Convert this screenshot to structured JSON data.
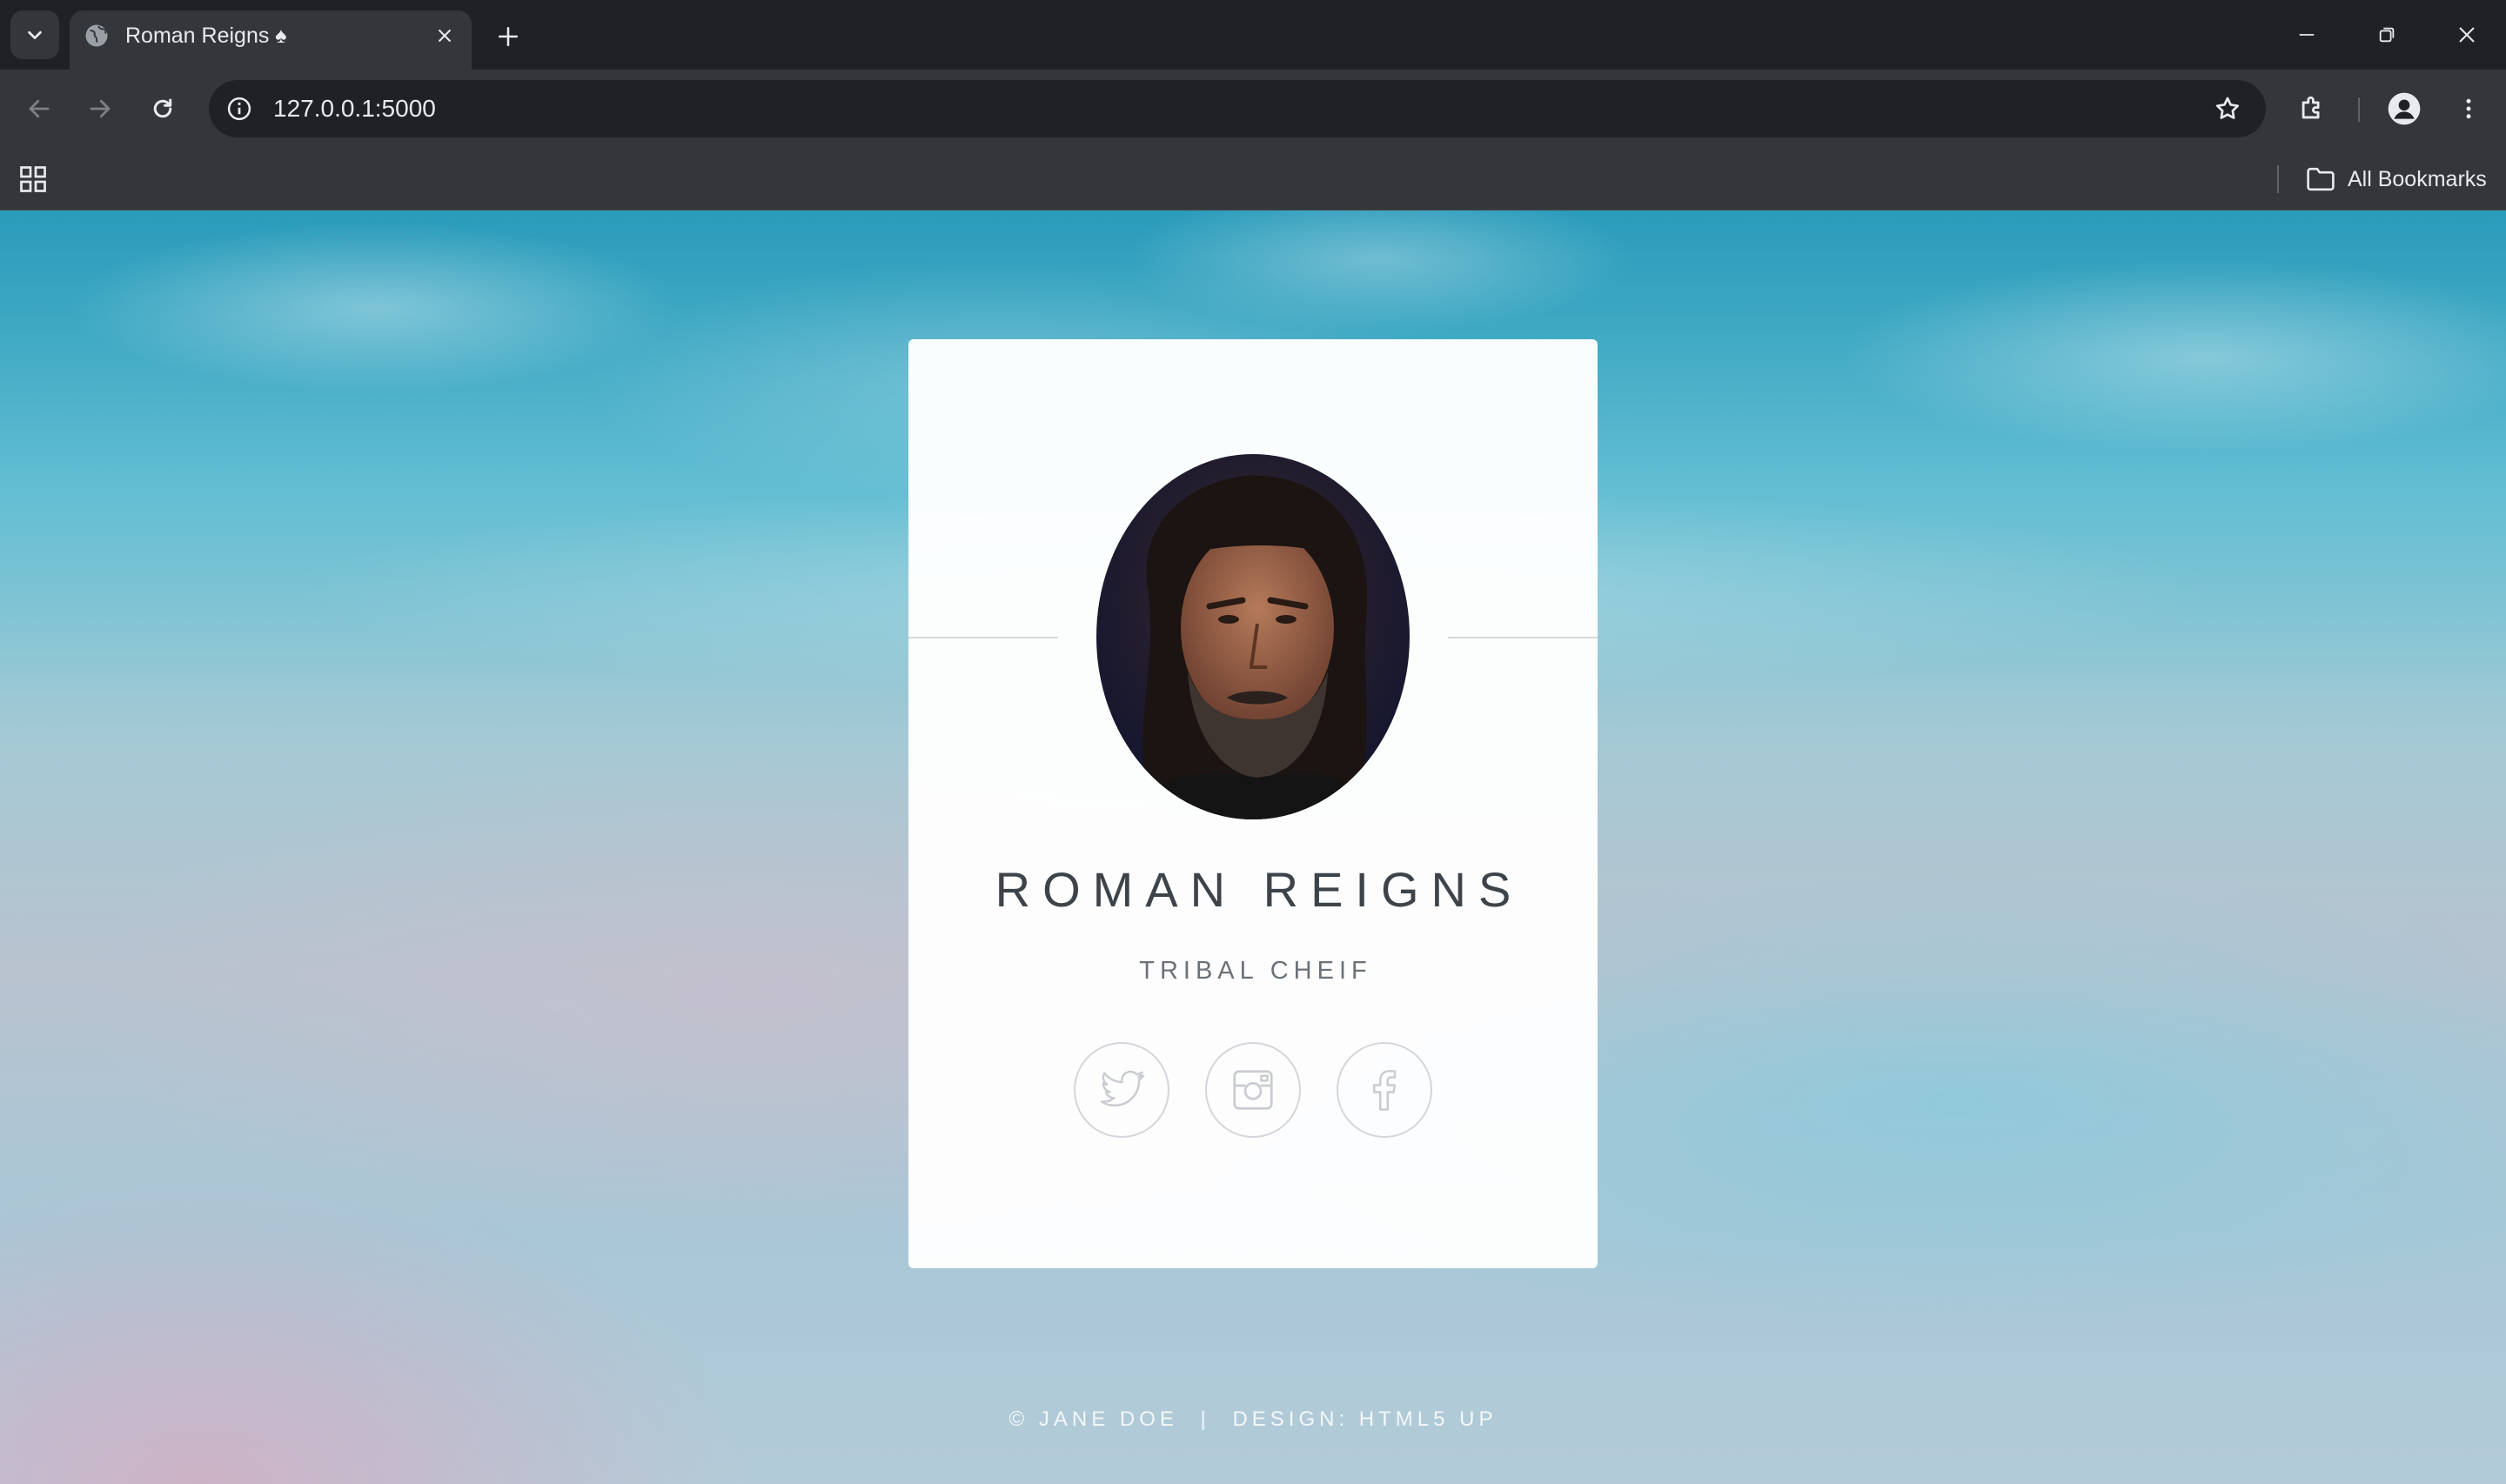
{
  "browser": {
    "tab_title": "Roman Reigns ♠",
    "url": "127.0.0.1:5000",
    "bookmarks_label": "All Bookmarks"
  },
  "icons": {
    "tab_menu": "chevron-down-icon",
    "favicon": "globe-icon",
    "close_tab": "close-icon",
    "new_tab": "plus-icon",
    "back": "arrow-left-icon",
    "forward": "arrow-right-icon",
    "reload": "reload-icon",
    "site_info": "info-icon",
    "bookmark": "star-icon",
    "extensions": "puzzle-icon",
    "profile": "profile-icon",
    "menu": "more-vertical-icon",
    "apps": "apps-grid-icon",
    "folder": "folder-icon",
    "social": [
      "twitter-icon",
      "instagram-icon",
      "facebook-icon"
    ]
  },
  "profile": {
    "name": "ROMAN REIGNS",
    "role": "TRIBAL CHEIF"
  },
  "footer": {
    "copyright": "© JANE DOE",
    "separator": "|",
    "credit": "DESIGN: HTML5 UP"
  },
  "colors": {
    "chrome_dark": "#202124",
    "chrome_toolbar": "#35363a",
    "chrome_text": "#e8eaed",
    "card_bg": "#ffffff",
    "name_text": "#3d4449",
    "icon_stroke": "#c9ccd0"
  }
}
